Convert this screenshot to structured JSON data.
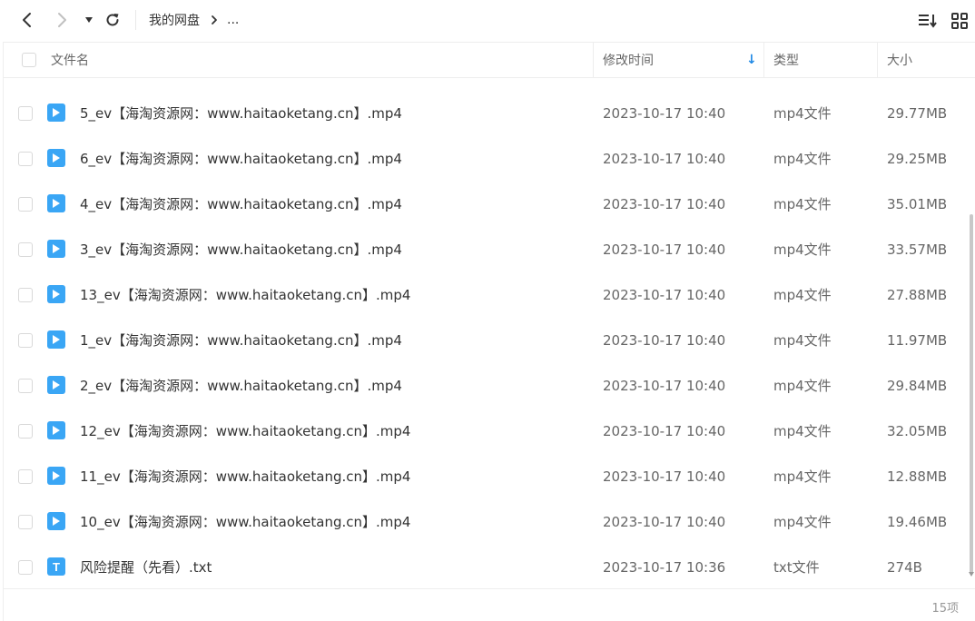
{
  "toolbar": {
    "breadcrumb_root": "我的网盘",
    "breadcrumb_more": "..."
  },
  "header": {
    "name": "文件名",
    "modified": "修改时间",
    "type": "类型",
    "size": "大小",
    "sort_indicator": "↓"
  },
  "files": [
    {
      "name": "5_ev【海淘资源网：www.haitaoketang.cn】.mp4",
      "modified": "2023-10-17 10:40",
      "type": "mp4文件",
      "size": "29.77MB",
      "icon": "video-icon"
    },
    {
      "name": "6_ev【海淘资源网：www.haitaoketang.cn】.mp4",
      "modified": "2023-10-17 10:40",
      "type": "mp4文件",
      "size": "29.25MB",
      "icon": "video-icon"
    },
    {
      "name": "4_ev【海淘资源网：www.haitaoketang.cn】.mp4",
      "modified": "2023-10-17 10:40",
      "type": "mp4文件",
      "size": "35.01MB",
      "icon": "video-icon"
    },
    {
      "name": "3_ev【海淘资源网：www.haitaoketang.cn】.mp4",
      "modified": "2023-10-17 10:40",
      "type": "mp4文件",
      "size": "33.57MB",
      "icon": "video-icon"
    },
    {
      "name": "13_ev【海淘资源网：www.haitaoketang.cn】.mp4",
      "modified": "2023-10-17 10:40",
      "type": "mp4文件",
      "size": "27.88MB",
      "icon": "video-icon"
    },
    {
      "name": "1_ev【海淘资源网：www.haitaoketang.cn】.mp4",
      "modified": "2023-10-17 10:40",
      "type": "mp4文件",
      "size": "11.97MB",
      "icon": "video-icon"
    },
    {
      "name": "2_ev【海淘资源网：www.haitaoketang.cn】.mp4",
      "modified": "2023-10-17 10:40",
      "type": "mp4文件",
      "size": "29.84MB",
      "icon": "video-icon"
    },
    {
      "name": "12_ev【海淘资源网：www.haitaoketang.cn】.mp4",
      "modified": "2023-10-17 10:40",
      "type": "mp4文件",
      "size": "32.05MB",
      "icon": "video-icon"
    },
    {
      "name": "11_ev【海淘资源网：www.haitaoketang.cn】.mp4",
      "modified": "2023-10-17 10:40",
      "type": "mp4文件",
      "size": "12.88MB",
      "icon": "video-icon"
    },
    {
      "name": "10_ev【海淘资源网：www.haitaoketang.cn】.mp4",
      "modified": "2023-10-17 10:40",
      "type": "mp4文件",
      "size": "19.46MB",
      "icon": "video-icon"
    },
    {
      "name": "风险提醒（先看）.txt",
      "modified": "2023-10-17 10:36",
      "type": "txt文件",
      "size": "274B",
      "icon": "txt-icon",
      "icon_letter": "T"
    }
  ],
  "footer": {
    "item_count": "15项"
  },
  "colors": {
    "accent": "#3aa6f5",
    "sort_arrow": "#1e88e5"
  }
}
